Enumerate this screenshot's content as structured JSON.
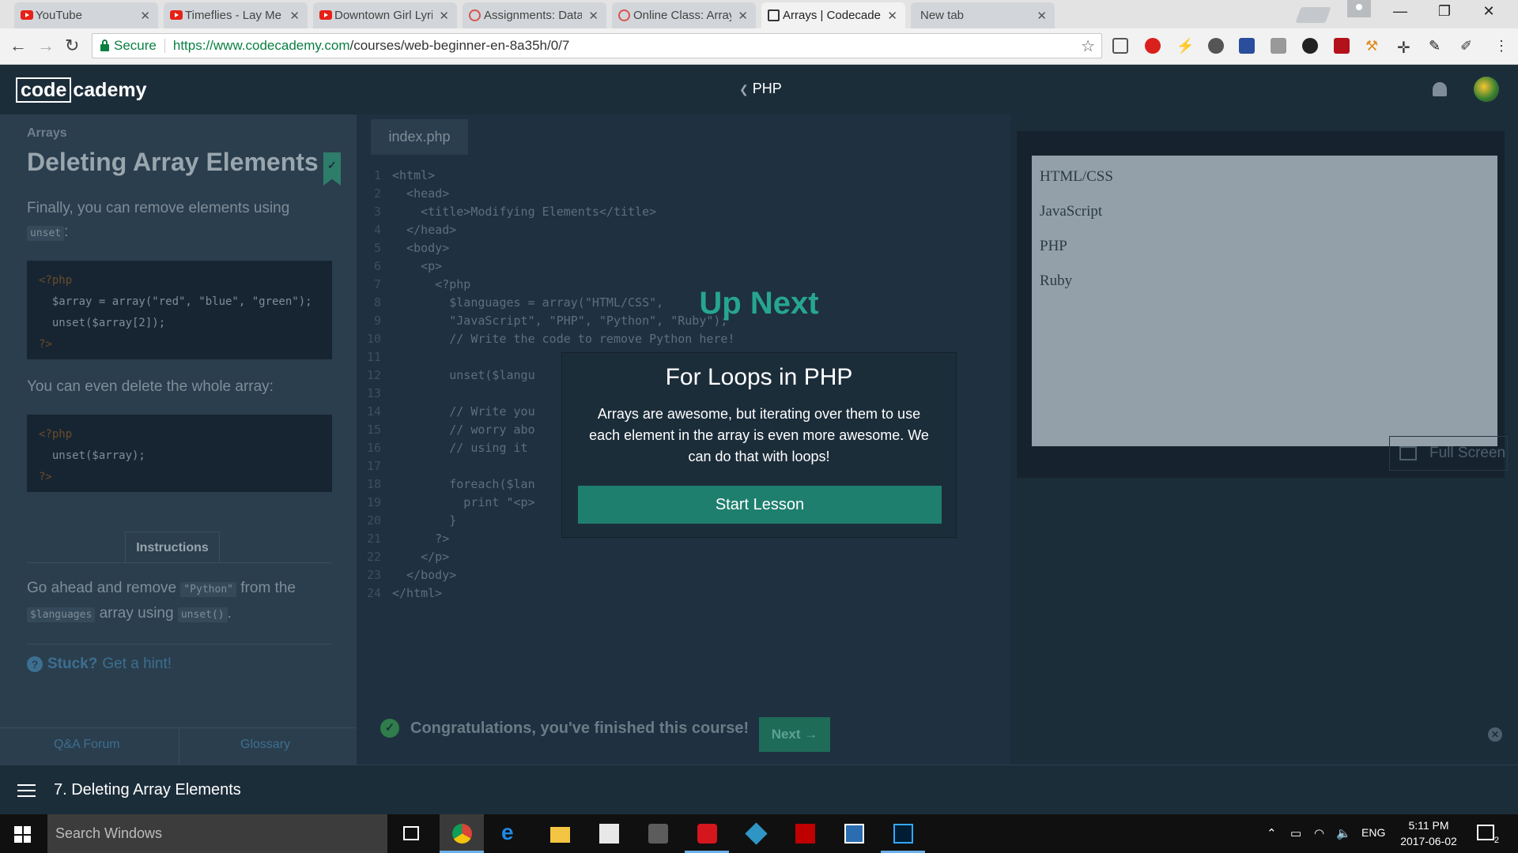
{
  "browser": {
    "tabs": [
      {
        "title": "YouTube",
        "icon": "youtube-icon"
      },
      {
        "title": "Timeflies - Lay Me Dow",
        "icon": "youtube-icon"
      },
      {
        "title": "Downtown Girl Lyrics -",
        "icon": "youtube-icon"
      },
      {
        "title": "Assignments: Database",
        "icon": "gear-icon"
      },
      {
        "title": "Online Class: Arrays in I",
        "icon": "gear-icon"
      },
      {
        "title": "Arrays | Codecademy",
        "icon": "codecademy-icon"
      },
      {
        "title": "New tab",
        "icon": ""
      }
    ],
    "secure_label": "Secure",
    "url_host": "https://www.codecademy.com",
    "url_path": "/courses/web-beginner-en-8a35h/0/7"
  },
  "header": {
    "logo_box": "code",
    "logo_rest": "cademy",
    "course_link": "PHP"
  },
  "lesson": {
    "breadcrumb": "Arrays",
    "title": "Deleting Array Elements",
    "para1": "Finally, you can remove elements using",
    "para1_code": "unset",
    "para1_end": ":",
    "code1": [
      "<?php",
      "  $array = array(\"red\", \"blue\", \"green\");",
      "  unset($array[2]);",
      "?>"
    ],
    "para2": "You can even delete the whole array:",
    "code2": [
      "<?php",
      "  unset($array);",
      "?>"
    ],
    "instructions_tab": "Instructions",
    "ins_pre": "Go ahead and remove",
    "ins_code1": "\"Python\"",
    "ins_mid": "from the",
    "ins_code2": "$languages",
    "ins_mid2": "array using",
    "ins_code3": "unset()",
    "ins_end": ".",
    "hint_bold": "Stuck?",
    "hint_text": "Get a hint!",
    "qa_forum": "Q&A Forum",
    "glossary": "Glossary"
  },
  "editor": {
    "file_tab": "index.php",
    "lines": [
      "<html>",
      "  <head>",
      "    <title>Modifying Elements</title>",
      "  </head>",
      "  <body>",
      "    <p>",
      "      <?php",
      "        $languages = array(\"HTML/CSS\",",
      "        \"JavaScript\", \"PHP\", \"Python\", \"Ruby\");",
      "        // Write the code to remove Python here!",
      "",
      "        unset($langu",
      "",
      "        // Write you",
      "        // worry abo",
      "        // using it",
      "",
      "        foreach($lan",
      "          print \"<p>",
      "        }",
      "      ?>",
      "    </p>",
      "  </body>",
      "</html>"
    ],
    "congrats": "Congratulations, you've finished this course!",
    "next_label": "Next →"
  },
  "preview": {
    "items": [
      "HTML/CSS",
      "JavaScript",
      "PHP",
      "Ruby"
    ],
    "fullscreen_label": "Full Screen"
  },
  "lesson_bar": {
    "title": "7. Deleting Array Elements"
  },
  "modal": {
    "up_next": "Up Next",
    "title": "For Loops in PHP",
    "description": "Arrays are awesome, but iterating over them to use each element in the array is even more awesome. We can do that with loops!",
    "button": "Start Lesson"
  },
  "taskbar": {
    "search_placeholder": "Search Windows",
    "language": "ENG",
    "time": "5:11 PM",
    "date": "2017-06-02",
    "notification_count": "2"
  },
  "colors": {
    "accent": "#1f7f6e",
    "up_next": "#26a690",
    "header_bg": "#1c2d3a"
  }
}
